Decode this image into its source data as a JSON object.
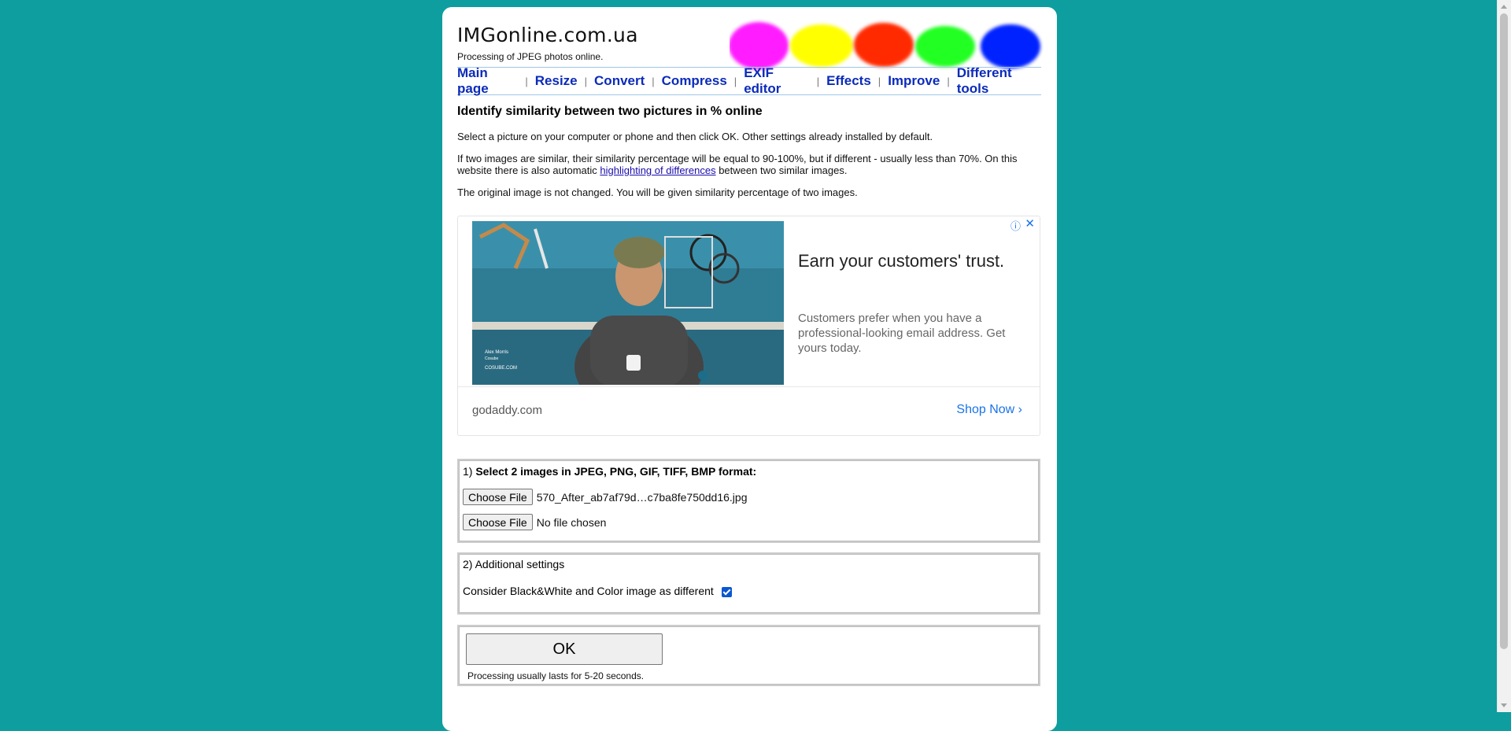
{
  "site": {
    "title": "IMGonline.com.ua",
    "subtitle": "Processing of JPEG photos online."
  },
  "nav": {
    "items": [
      "Main page",
      "Resize",
      "Convert",
      "Compress",
      "EXIF editor",
      "Effects",
      "Improve",
      "Different tools"
    ],
    "separator": "|"
  },
  "content": {
    "heading": "Identify similarity between two pictures in % online",
    "para1": "Select a picture on your computer or phone and then click OK. Other settings already installed by default.",
    "para2_before": "If two images are similar, their similarity percentage will be equal to 90-100%, but if different - usually less than 70%. On this website there is also automatic ",
    "para2_link": "highlighting of differences",
    "para2_after": " between two similar images.",
    "para3": "The original image is not changed. You will be given similarity percentage of two images."
  },
  "ad": {
    "headline": "Earn your customers' trust.",
    "body": "Customers prefer when you have a professional-looking email address. Get yours today.",
    "domain": "godaddy.com",
    "cta": "Shop Now",
    "photo_caption_name": "Alex Morris",
    "photo_caption_role": "Cosube",
    "photo_caption_site": "COSUBE.COM"
  },
  "form": {
    "step1_prefix": "1) ",
    "step1_label": "Select 2 images in JPEG, PNG, GIF, TIFF, BMP format:",
    "file1_button": "Choose File",
    "file1_value": "570_After_ab7af79d…c7ba8fe750dd16.jpg",
    "file2_button": "Choose File",
    "file2_value": "No file chosen",
    "step2_label": "2) Additional settings",
    "bw_label": "Consider Black&White and Color image as different",
    "bw_checked": true,
    "ok_button": "OK",
    "ok_note": "Processing usually lasts for 5-20 seconds."
  },
  "colors": {
    "background": "#0e9e9f",
    "nav_link": "#0b2bb9",
    "blob_colors": [
      "#ff1aff",
      "#ffff00",
      "#ff2a00",
      "#22ff22",
      "#0022ff"
    ]
  }
}
